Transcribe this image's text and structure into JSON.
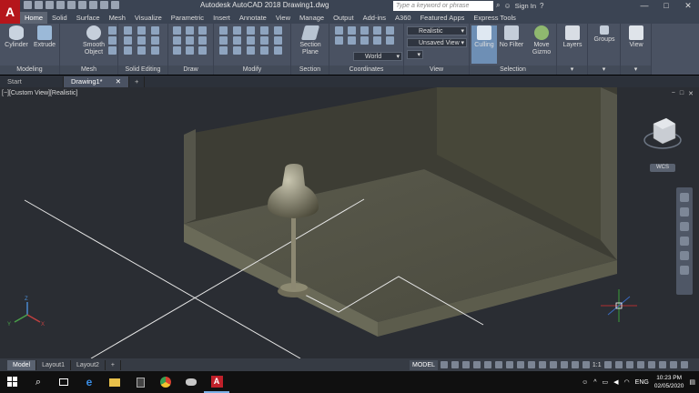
{
  "titlebar": {
    "logo": "A",
    "title": "Autodesk AutoCAD 2018    Drawing1.dwg",
    "search_placeholder": "Type a keyword or phrase",
    "signin": "Sign In",
    "minimize": "—",
    "maximize": "□",
    "close": "✕"
  },
  "ribbon_tabs": [
    "Home",
    "Solid",
    "Surface",
    "Mesh",
    "Visualize",
    "Parametric",
    "Insert",
    "Annotate",
    "View",
    "Manage",
    "Output",
    "Add-ins",
    "A360",
    "Featured Apps",
    "Express Tools"
  ],
  "active_tab": "Home",
  "ribbon": {
    "modeling": {
      "label": "Modeling",
      "buttons": [
        "Cylinder",
        "Extrude"
      ]
    },
    "mesh": {
      "label": "Mesh",
      "buttons": [
        "Smooth Object"
      ]
    },
    "solid_editing": {
      "label": "Solid Editing"
    },
    "draw": {
      "label": "Draw"
    },
    "modify": {
      "label": "Modify"
    },
    "section": {
      "label": "Section",
      "buttons": [
        "Section Plane"
      ]
    },
    "coordinates": {
      "label": "Coordinates",
      "world": "World"
    },
    "view": {
      "label": "View",
      "visual_style": "Realistic",
      "view_name": "Unsaved View"
    },
    "selection": {
      "label": "Selection",
      "buttons": [
        "Culling",
        "No Filter",
        "Move Gizmo"
      ]
    },
    "layers": {
      "label": "Layers"
    },
    "groups": {
      "label": "Groups"
    },
    "view_panel": {
      "label": "View"
    }
  },
  "doc_tabs": [
    "Start",
    "Drawing1*"
  ],
  "viewport": {
    "label": "[−][Custom View][Realistic]",
    "controls": [
      "−",
      "□",
      "✕"
    ],
    "wcs": "WCS"
  },
  "layout_tabs": [
    "Model",
    "Layout1",
    "Layout2"
  ],
  "status": {
    "model": "MODEL",
    "scale": "1:1"
  },
  "taskbar": {
    "lang": "ENG",
    "time": "10:23 PM",
    "date": "02/05/2020"
  }
}
